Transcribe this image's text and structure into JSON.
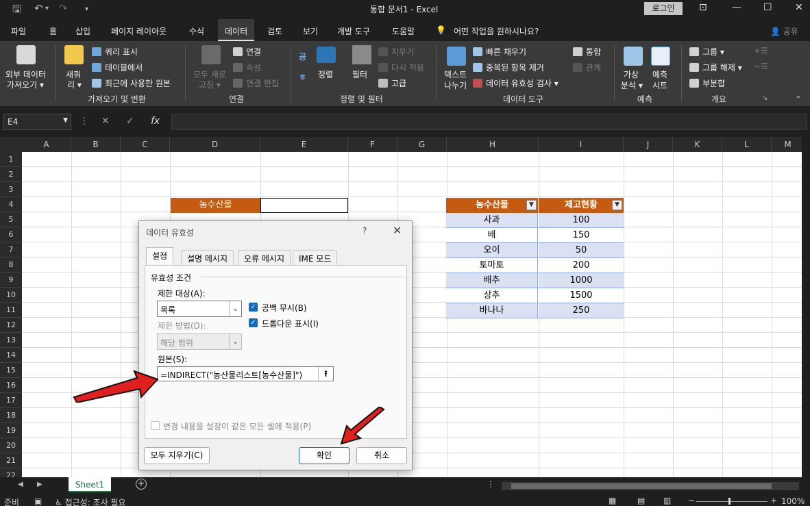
{
  "window": {
    "title": "통합 문서1  -  Excel",
    "login_label": "로그인",
    "minimize_glyph": "—",
    "maximize_glyph": "☐",
    "close_glyph": "✕",
    "restore_glyph": "⊡"
  },
  "menu": {
    "tabs": [
      "파일",
      "홈",
      "삽입",
      "페이지 레이아웃",
      "수식",
      "데이터",
      "검토",
      "보기",
      "개발 도구",
      "도움말"
    ],
    "tell_me": "어떤 작업을 원하시나요?",
    "share": "공유"
  },
  "ribbon": {
    "get_external": "외부 데이터",
    "get_external_2": "가져오기 ▾",
    "new_query": "새쿼",
    "new_query_2": "리 ▾",
    "show_queries": "쿼리 표시",
    "from_table": "테이블에서",
    "recent_sources": "최근에 사용한 원본",
    "group_get_transform": "가져오기 및 변환",
    "refresh_all": "모두 새로",
    "refresh_all_2": "고침 ▾",
    "connections": "연결",
    "properties": "속성",
    "edit_links": "연결 편집",
    "group_connections": "연결",
    "sort_az": "공",
    "sort_za": "ㅎ",
    "sort": "정렬",
    "filter": "필터",
    "clear": "지우기",
    "reapply": "다시 적용",
    "advanced": "고급",
    "group_sort_filter": "정렬 및 필터",
    "text_to_columns": "텍스트",
    "text_to_columns_2": "나누기",
    "flash_fill": "빠른 채우기",
    "remove_duplicates": "중복된 항목 제거",
    "data_validation": "데이터 유효성 검사",
    "consolidate": "통합",
    "relationships": "관계",
    "group_data_tools": "데이터 도구",
    "what_if": "가상",
    "what_if_2": "분석 ▾",
    "forecast": "예측",
    "forecast_2": "시트",
    "group_forecast": "예측",
    "group": "그룹",
    "ungroup": "그룹 해제",
    "subtotal": "부분합",
    "group_outline": "개요"
  },
  "formula_bar": {
    "name_box": "E4",
    "fx": "fx"
  },
  "grid": {
    "columns": [
      "A",
      "B",
      "C",
      "D",
      "E",
      "F",
      "G",
      "H",
      "I",
      "J",
      "K",
      "L",
      "M"
    ],
    "rows": [
      "1",
      "2",
      "3",
      "4",
      "5",
      "6",
      "7",
      "8",
      "9",
      "10",
      "11",
      "12",
      "13",
      "14",
      "15",
      "16",
      "17",
      "18",
      "19",
      "20",
      "21",
      "22"
    ],
    "d4_label": "농수산물",
    "table": {
      "headers": [
        "농수산물",
        "제고현황"
      ],
      "rows": [
        [
          "사과",
          "100"
        ],
        [
          "배",
          "150"
        ],
        [
          "오이",
          "50"
        ],
        [
          "토마토",
          "200"
        ],
        [
          "배추",
          "1000"
        ],
        [
          "상추",
          "1500"
        ],
        [
          "바나나",
          "250"
        ]
      ]
    }
  },
  "sheet_tabs": {
    "active": "Sheet1"
  },
  "status": {
    "ready": "준비",
    "accessibility": "접근성: 조사 필요",
    "zoom": "100%"
  },
  "dialog": {
    "title": "데이터 유효성",
    "help": "?",
    "close": "✕",
    "tabs": [
      "설정",
      "설명 메시지",
      "오류 메시지",
      "IME 모드"
    ],
    "criteria_heading": "유효성 조건",
    "allow_label": "제한 대상(A):",
    "allow_value": "목록",
    "ignore_blank": "공백 무시(B)",
    "in_cell_dropdown": "드롭다운 표시(I)",
    "data_label": "제한 방법(D):",
    "data_value": "해당 범위",
    "source_label": "원본(S):",
    "source_value": "=INDIRECT(\"농산물리스트[농수산물]\")",
    "apply_all": "변경 내용을 설정이 같은 모든 셀에 적용(P)",
    "clear_all": "모두 지우기(C)",
    "ok": "확인",
    "cancel": "취소"
  },
  "colors": {
    "header_orange": "#c55a11",
    "band_blue": "#d9e1f2",
    "accent_blue": "#0f6cbd",
    "annotation_red": "#e0201f"
  }
}
